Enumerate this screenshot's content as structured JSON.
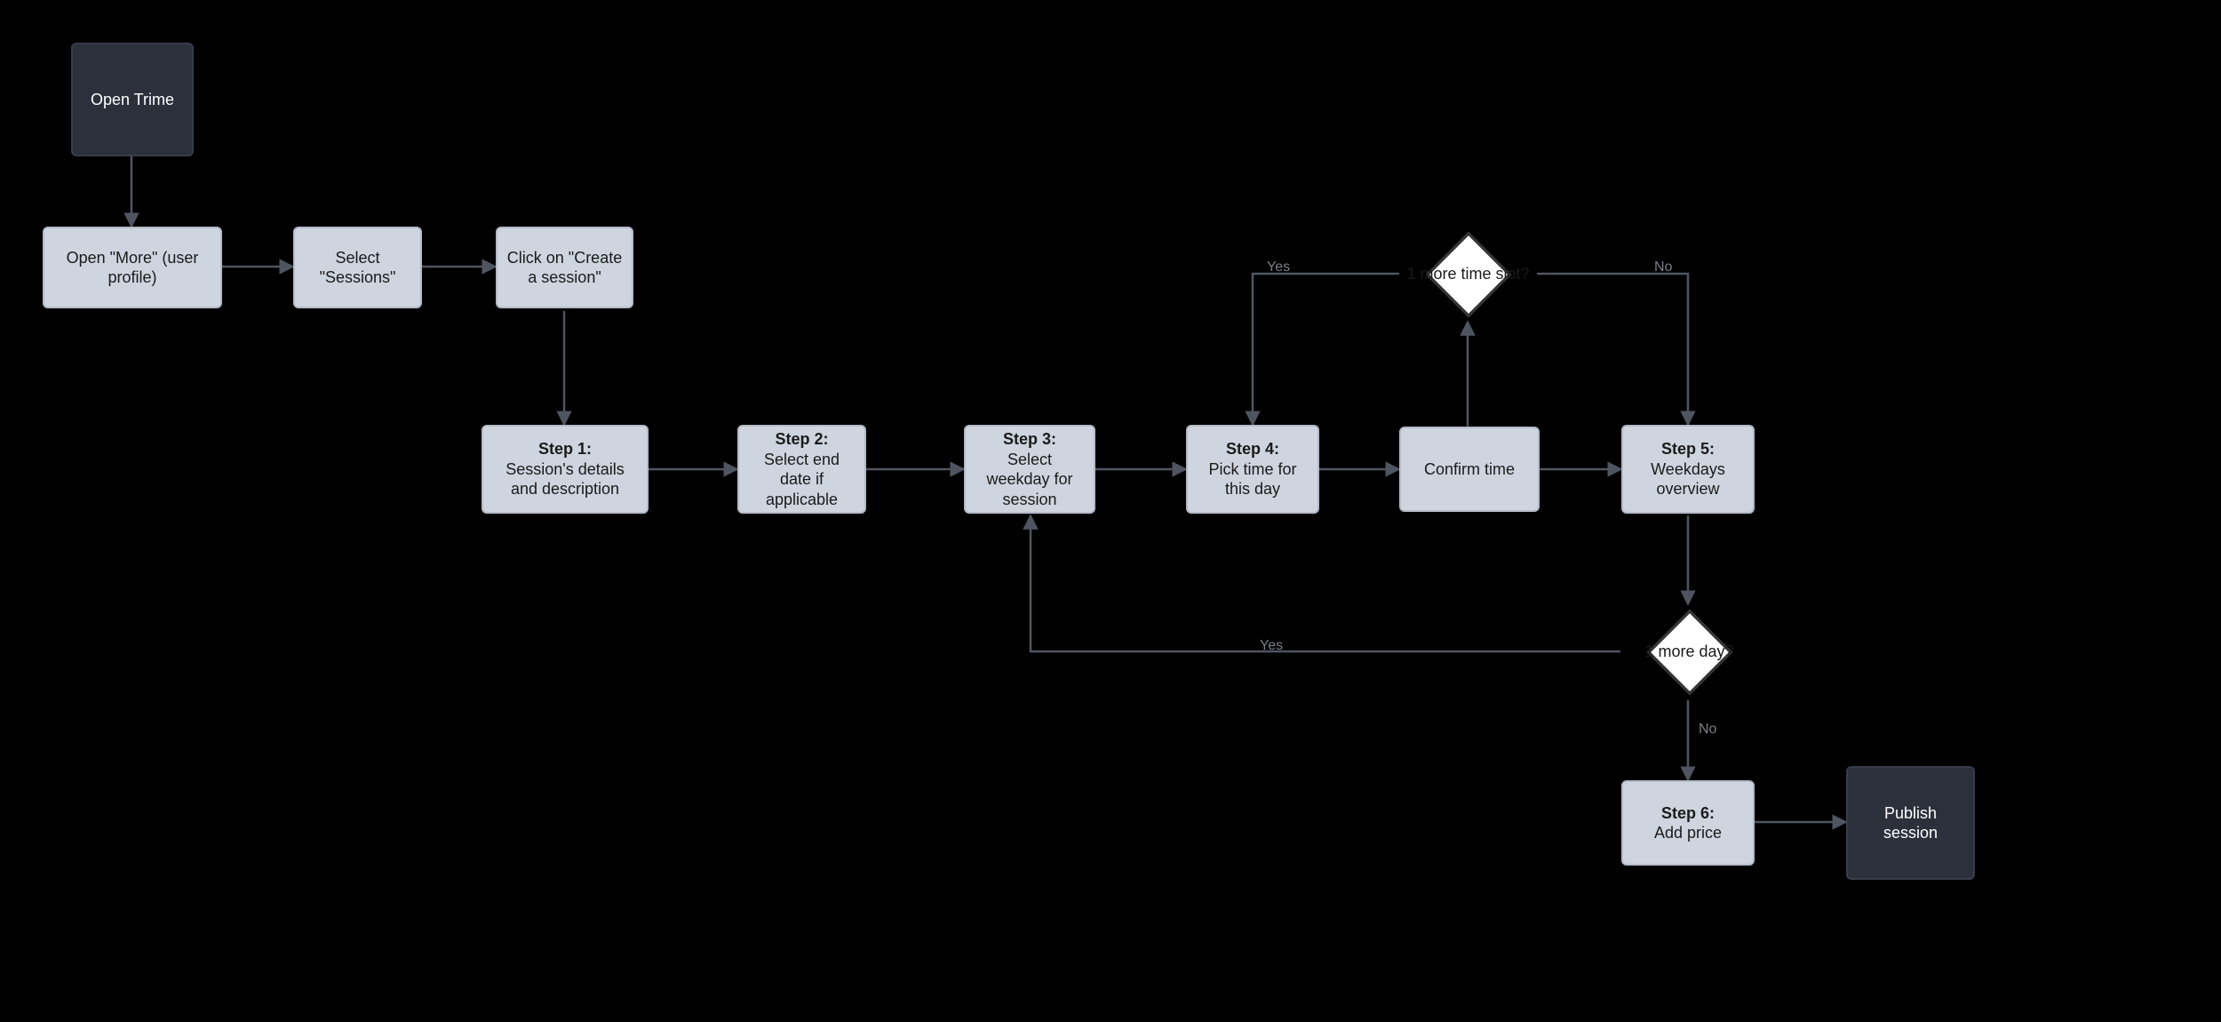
{
  "nodes": {
    "open_trime": "Open Trime",
    "open_more": "Open \"More\" (user profile)",
    "select_sessions": "Select \"Sessions\"",
    "create_session": "Click on \"Create a session\"",
    "step1": {
      "title": "Step 1:",
      "desc": "Session's details and description"
    },
    "step2": {
      "title": "Step 2:",
      "desc": "Select end date if applicable"
    },
    "step3": {
      "title": "Step 3:",
      "desc": "Select weekday for session"
    },
    "step4": {
      "title": "Step 4:",
      "desc": "Pick time for this day"
    },
    "confirm_time": "Confirm time",
    "step5": {
      "title": "Step 5:",
      "desc": "Weekdays overview"
    },
    "step6": {
      "title": "Step 6:",
      "desc": "Add price"
    },
    "publish": "Publish session",
    "decision_time_slot": "1 more time slot?",
    "decision_day": "1 more day?"
  },
  "edge_labels": {
    "yes1": "Yes",
    "no1": "No",
    "yes2": "Yes",
    "no2": "No"
  },
  "colors": {
    "dark_node_bg": "#2b303b",
    "light_node_bg": "#cfd5df",
    "diamond_bg": "#ffffff",
    "edge": "#4f5560"
  }
}
